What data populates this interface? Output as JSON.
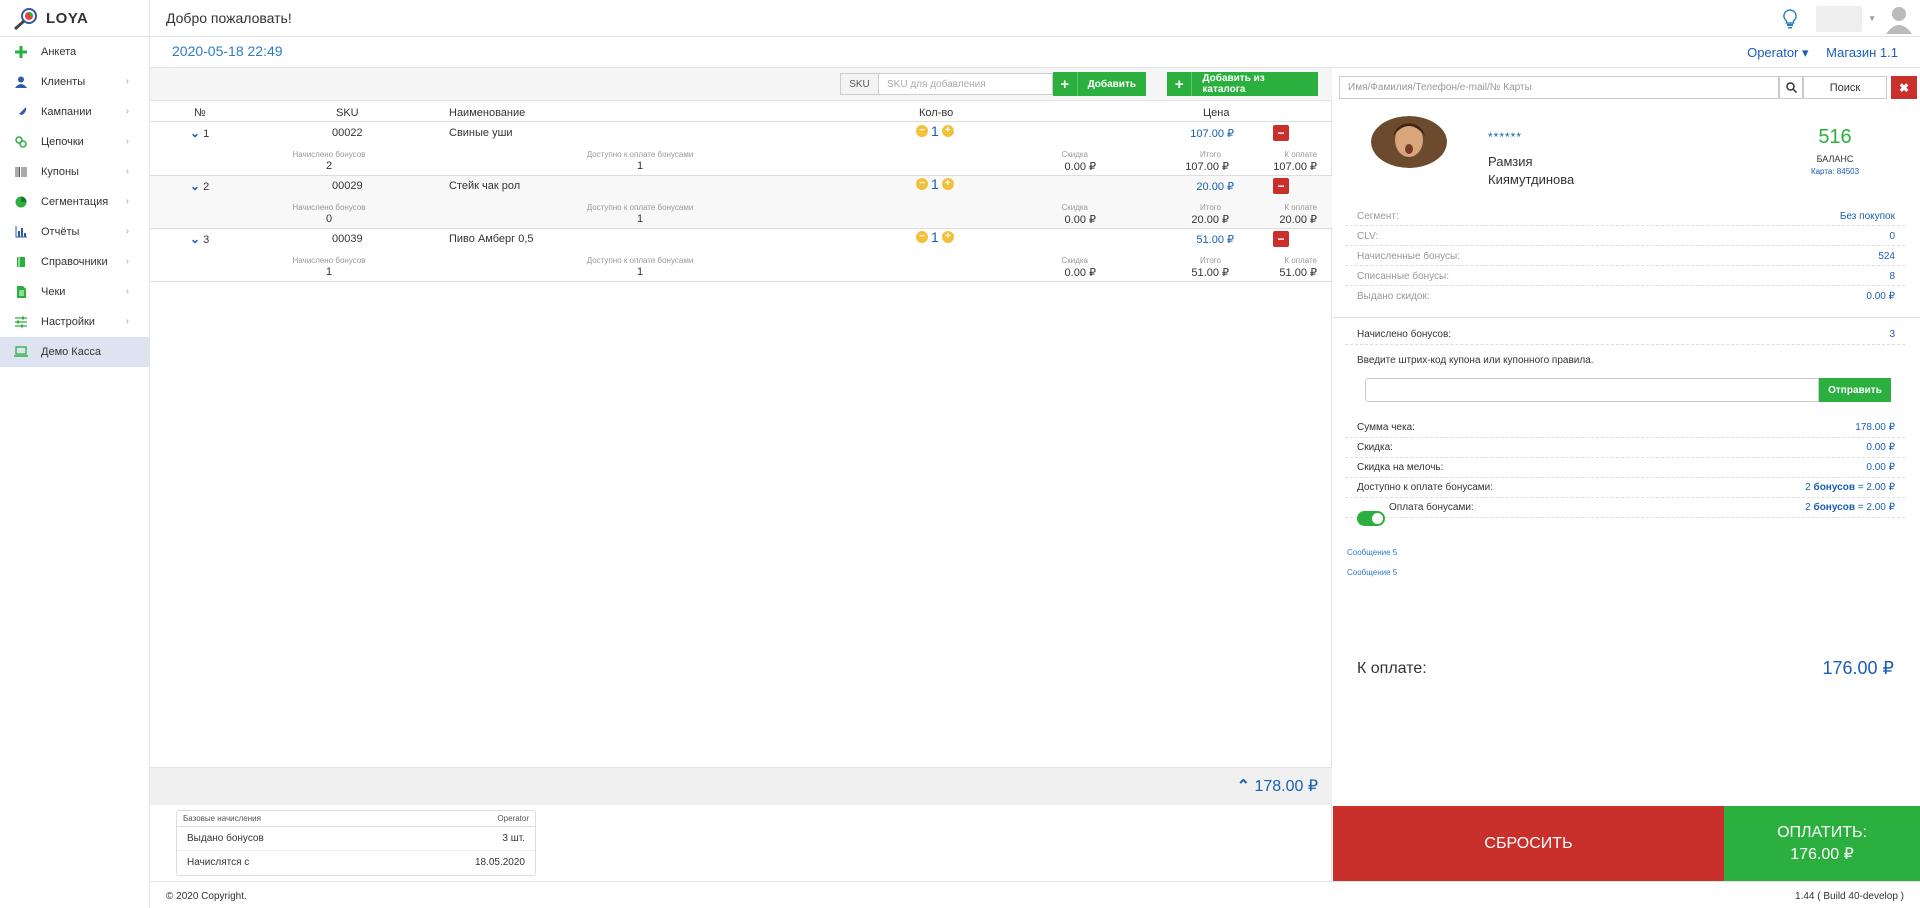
{
  "brand": {
    "name": "LOYA"
  },
  "header": {
    "welcome": "Добро пожаловать!"
  },
  "subbar": {
    "datetime": "2020-05-18 22:49",
    "operator": "Operator ▾",
    "store": "Магазин 1.1"
  },
  "sidebar": {
    "items": [
      {
        "label": "Анкета",
        "icon": "plus-icon",
        "has_arrow": false
      },
      {
        "label": "Клиенты",
        "icon": "user-icon",
        "has_arrow": true
      },
      {
        "label": "Кампании",
        "icon": "rocket-icon",
        "has_arrow": true
      },
      {
        "label": "Цепочки",
        "icon": "link-icon",
        "has_arrow": true
      },
      {
        "label": "Купоны",
        "icon": "barcode-icon",
        "has_arrow": true
      },
      {
        "label": "Сегментация",
        "icon": "pie-chart-icon",
        "has_arrow": true
      },
      {
        "label": "Отчёты",
        "icon": "bar-chart-icon",
        "has_arrow": true
      },
      {
        "label": "Справочники",
        "icon": "book-icon",
        "has_arrow": true
      },
      {
        "label": "Чеки",
        "icon": "receipt-icon",
        "has_arrow": true
      },
      {
        "label": "Настройки",
        "icon": "sliders-icon",
        "has_arrow": true
      },
      {
        "label": "Демо Касса",
        "icon": "laptop-icon",
        "has_arrow": false,
        "active": true
      }
    ]
  },
  "skubar": {
    "label": "SKU",
    "placeholder": "SKU для добавления",
    "add": "Добавить",
    "add_catalog": "Добавить из каталога"
  },
  "table": {
    "headers": {
      "num": "№",
      "sku": "SKU",
      "name": "Наименование",
      "qty": "Кол-во",
      "price": "Цена"
    },
    "sub_labels": {
      "bonus_earned": "Начислено бонусов",
      "bonus_avail": "Доступно к оплате бонусами",
      "discount": "Скидка",
      "total": "Итого",
      "to_pay": "К оплате"
    },
    "rows": [
      {
        "num": "1",
        "sku": "00022",
        "name": "Свиные уши",
        "qty": "1",
        "price": "107.00 ₽",
        "bonus_earned": "2",
        "bonus_avail": "1",
        "discount": "0.00 ₽",
        "total": "107.00 ₽",
        "to_pay": "107.00 ₽"
      },
      {
        "num": "2",
        "sku": "00029",
        "name": "Стейк чак рол",
        "qty": "1",
        "price": "20.00 ₽",
        "bonus_earned": "0",
        "bonus_avail": "1",
        "discount": "0.00 ₽",
        "total": "20.00 ₽",
        "to_pay": "20.00 ₽"
      },
      {
        "num": "3",
        "sku": "00039",
        "name": "Пиво Амберг 0,5",
        "qty": "1",
        "price": "51.00 ₽",
        "bonus_earned": "1",
        "bonus_avail": "1",
        "discount": "0.00 ₽",
        "total": "51.00 ₽",
        "to_pay": "51.00 ₽"
      }
    ]
  },
  "total": "178.00 ₽",
  "base_box": {
    "title": "Базовые начисления",
    "operator": "Operator",
    "rows": [
      {
        "k": "Выдано бонусов",
        "v": "3 шт."
      },
      {
        "k": "Начислятся с",
        "v": "18.05.2020"
      }
    ]
  },
  "right": {
    "search_placeholder": "Имя/Фамилия/Телефон/e-mail/№ Карты",
    "search_btn": "Поиск",
    "close": "✖",
    "stars": "******",
    "name_first": "Рамзия",
    "name_last": "Киямутдинова",
    "balance_value": "516",
    "balance_label": "БАЛАНС",
    "card": "Карта: 84503",
    "info": [
      {
        "k": "Сегмент:",
        "v": "Без покупок"
      },
      {
        "k": "CLV:",
        "v": "0"
      },
      {
        "k": "Начисленные бонусы:",
        "v": "524"
      },
      {
        "k": "Списанные бонусы:",
        "v": "8"
      },
      {
        "k": "Выдано скидок:",
        "v": "0.00 ₽"
      }
    ],
    "bonus_earned_k": "Начислено бонусов:",
    "bonus_earned_v": "3",
    "coupon_label": "Введите штрих-код купона или купонного правила.",
    "send": "Отправить",
    "sum_k": "Сумма чека:",
    "sum_v": "178.00 ₽",
    "discount_k": "Скидка:",
    "discount_v": "0.00 ₽",
    "change_k": "Скидка на мелочь:",
    "change_v": "0.00 ₽",
    "avail_k": "Доступно к оплате бонусами:",
    "avail_n": "2",
    "avail_word": "бонусов",
    "avail_eq": "= 2.00 ₽",
    "paybonus_k": "Оплата бонусами:",
    "paybonus_n": "2",
    "paybonus_word": "бонусов",
    "paybonus_eq": "= 2.00 ₽",
    "toggle_on": true,
    "msg1": "Сообщение 5",
    "msg2": "Сообщение 5",
    "topay_k": "К оплате:",
    "topay_v": "176.00 ₽"
  },
  "actions": {
    "reset": "СБРОСИТЬ",
    "pay_l1": "ОПЛАТИТЬ:",
    "pay_l2": "176.00 ₽"
  },
  "footer": {
    "copyright": "© 2020 Copyright.",
    "version": "1.44 ( Build 40-develop )"
  },
  "colors": {
    "accent": "#1a5eb5",
    "green": "#2bb03f",
    "red": "#c9302c",
    "link": "#2c7dc8"
  }
}
